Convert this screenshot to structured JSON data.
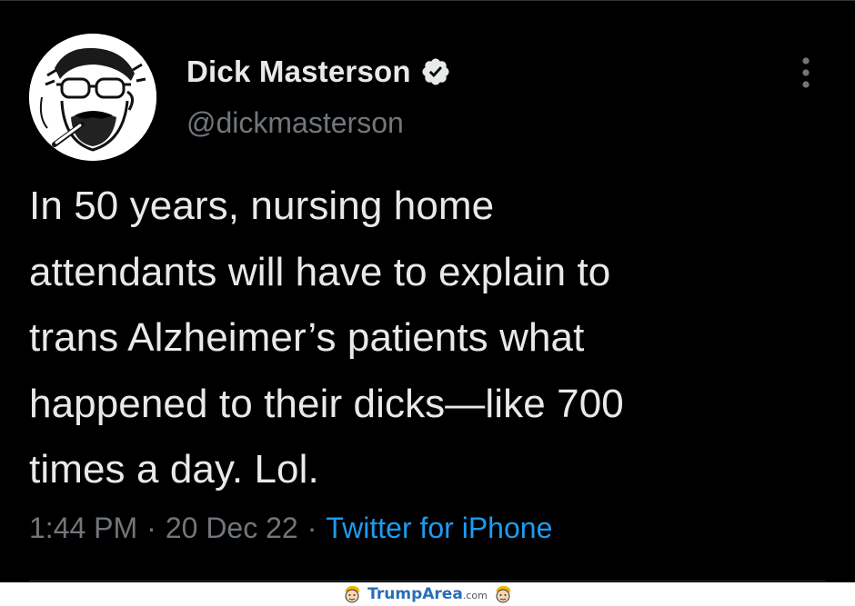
{
  "tweet": {
    "display_name": "Dick Masterson",
    "handle": "@dickmasterson",
    "verified": true,
    "text_lines": [
      "In 50 years, nursing home",
      "attendants will have to explain to",
      "trans Alzheimer’s patients what",
      "happened to their dicks—like 700",
      "times a day. Lol."
    ],
    "time": "1:44 PM",
    "separator": "·",
    "date": "20 Dec 22",
    "source": "Twitter for iPhone"
  },
  "watermark": {
    "brand": "TrumpArea",
    "tld": ".com"
  },
  "colors": {
    "background": "#000000",
    "text_primary": "#e7e9ea",
    "text_secondary": "#71767b",
    "link": "#1d9bf0",
    "divider": "#2f3336",
    "watermark_brand": "#2a6db5"
  },
  "icons": {
    "avatar": "avatar-sketch-portrait",
    "verified": "verified-badge-icon",
    "more": "more-options-vertical-dots-icon",
    "watermark_face": "cartoon-face-icon"
  }
}
